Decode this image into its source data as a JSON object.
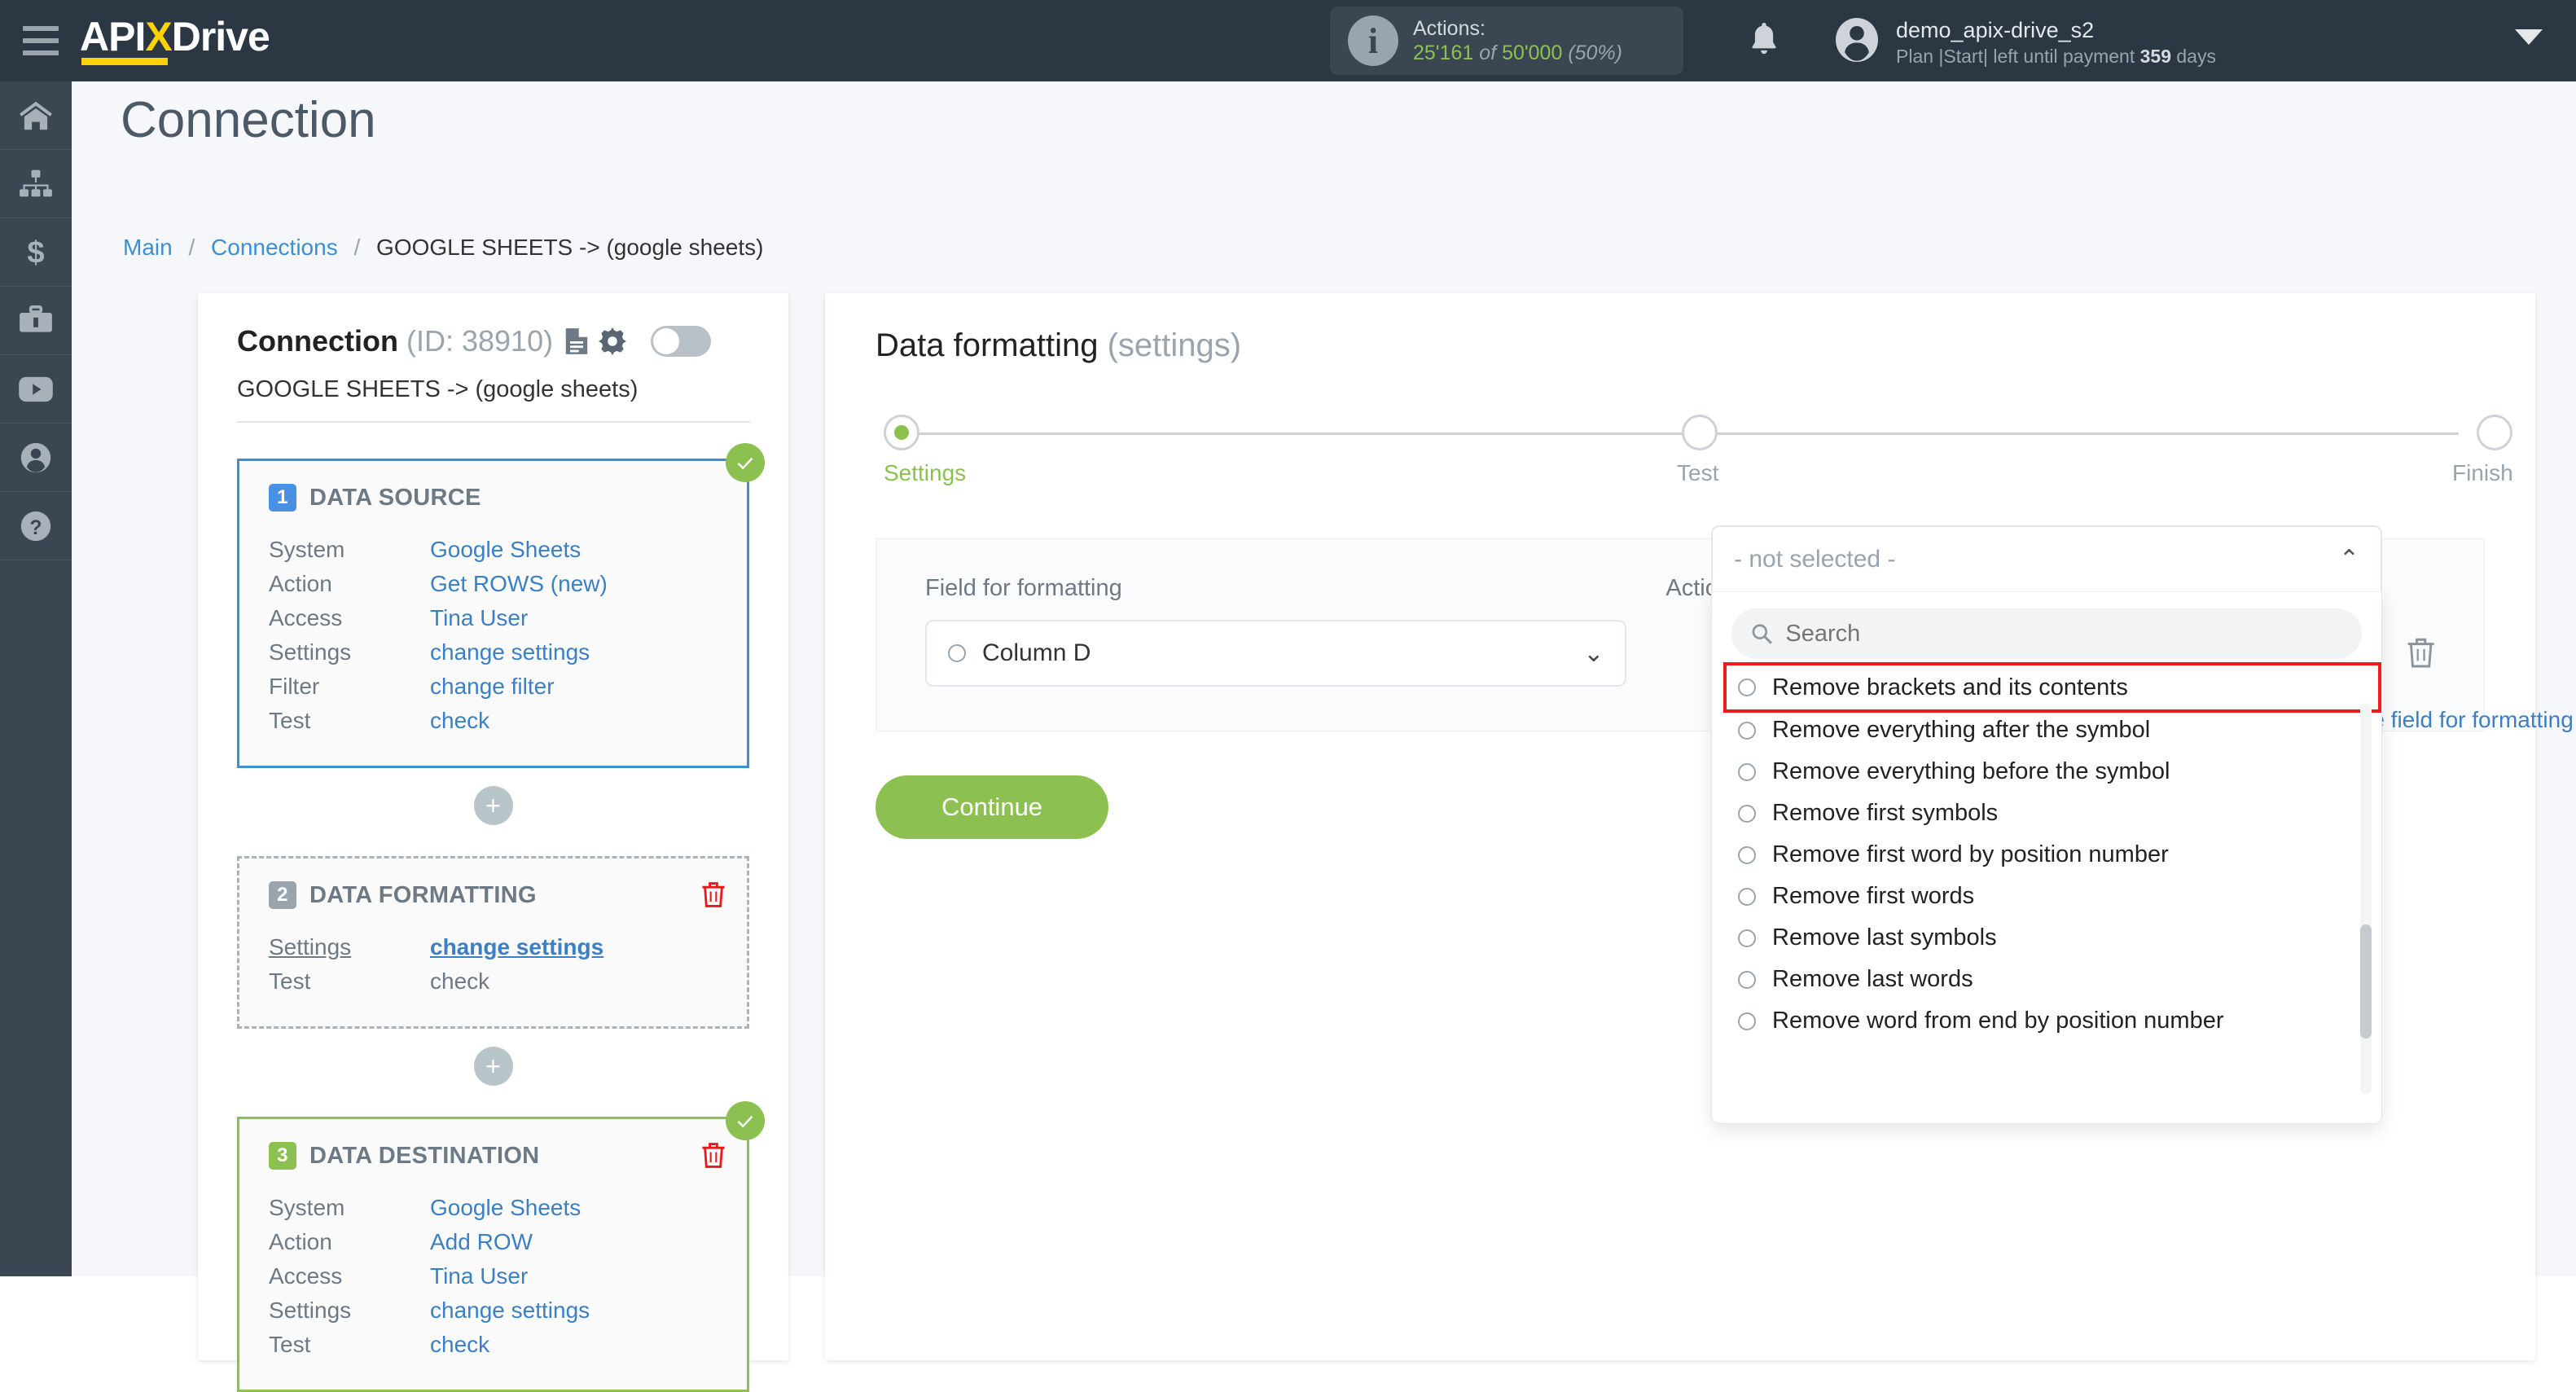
{
  "header": {
    "logo_api": "API",
    "logo_x": "X",
    "logo_drive": "Drive",
    "actions_label": "Actions:",
    "actions_used": "25'161",
    "actions_of": "of",
    "actions_total": "50'000",
    "actions_percent": "(50%)",
    "username": "demo_apix-drive_s2",
    "plan_prefix": "Plan |Start| left until payment",
    "plan_days": "359",
    "plan_suffix": "days"
  },
  "rail": {
    "items": [
      {
        "name": "home-icon",
        "label": "Home"
      },
      {
        "name": "connections-icon",
        "label": "Connections"
      },
      {
        "name": "billing-icon",
        "label": "Billing"
      },
      {
        "name": "briefcase-icon",
        "label": "Business"
      },
      {
        "name": "youtube-icon",
        "label": "Video"
      },
      {
        "name": "account-icon",
        "label": "Account"
      },
      {
        "name": "help-icon",
        "label": "Help"
      }
    ]
  },
  "page": {
    "title": "Connection",
    "breadcrumb": {
      "main": "Main",
      "connections": "Connections",
      "current": "GOOGLE SHEETS -> (google sheets)"
    }
  },
  "connection_card": {
    "title": "Connection",
    "id_text": "(ID: 38910)",
    "subtitle": "GOOGLE SHEETS -> (google sheets)",
    "blocks": [
      {
        "number": "1",
        "heading": "DATA SOURCE",
        "rows": [
          {
            "key": "System",
            "value": "Google Sheets"
          },
          {
            "key": "Action",
            "value": "Get ROWS (new)"
          },
          {
            "key": "Access",
            "value": "Tina User"
          },
          {
            "key": "Settings",
            "value": "change settings"
          },
          {
            "key": "Filter",
            "value": "change filter"
          },
          {
            "key": "Test",
            "value": "check"
          }
        ]
      },
      {
        "number": "2",
        "heading": "DATA FORMATTING",
        "rows": [
          {
            "key": "Settings",
            "value": "change settings"
          },
          {
            "key": "Test",
            "value": "check"
          }
        ]
      },
      {
        "number": "3",
        "heading": "DATA DESTINATION",
        "rows": [
          {
            "key": "System",
            "value": "Google Sheets"
          },
          {
            "key": "Action",
            "value": "Add ROW"
          },
          {
            "key": "Access",
            "value": "Tina User"
          },
          {
            "key": "Settings",
            "value": "change settings"
          },
          {
            "key": "Test",
            "value": "check"
          }
        ]
      }
    ],
    "add_button_label": "+"
  },
  "settings_panel": {
    "title": "Data formatting",
    "title_muted": "(settings)",
    "steps": [
      {
        "label": "Settings",
        "state": "active"
      },
      {
        "label": "Test",
        "state": "pending"
      },
      {
        "label": "Finish",
        "state": "pending"
      }
    ],
    "field_label": "Field for formatting",
    "field_value": "Column D",
    "action_label": "Action",
    "action_value": "- not selected -",
    "add_field_link": "Add one more field for formatting",
    "continue_label": "Continue"
  },
  "dropdown": {
    "search_placeholder": "Search",
    "options": [
      "Remove brackets and its contents",
      "Remove everything after the symbol",
      "Remove everything before the symbol",
      "Remove first symbols",
      "Remove first word by position number",
      "Remove first words",
      "Remove last symbols",
      "Remove last words",
      "Remove word from end by position number"
    ],
    "highlighted_index": 0
  },
  "colors": {
    "brand_dark": "#2b3742",
    "brand_yellow": "#fdd204",
    "accent_blue": "#3b8fd4",
    "accent_green": "#8cc152",
    "highlight_red": "#f01c1c"
  }
}
